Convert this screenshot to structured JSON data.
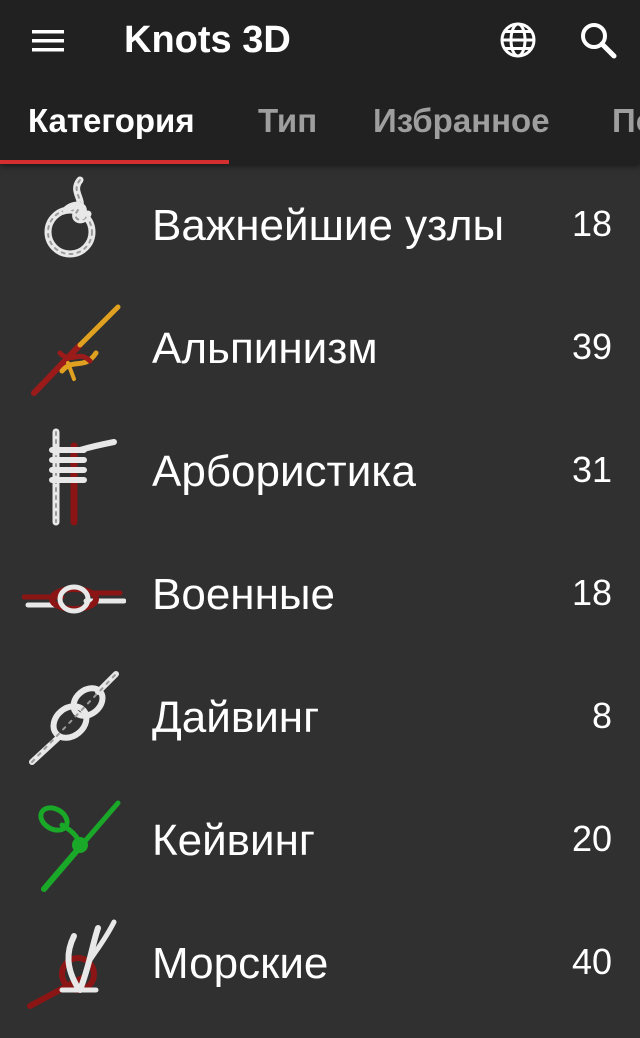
{
  "toolbar": {
    "title": "Knots 3D",
    "menu_icon": "hamburger-menu-icon",
    "language_icon": "globe-icon",
    "search_icon": "search-icon"
  },
  "tabs": [
    {
      "label": "Категория",
      "active": true
    },
    {
      "label": "Тип",
      "active": false
    },
    {
      "label": "Избранное",
      "active": false
    },
    {
      "label": "По",
      "active": false
    }
  ],
  "categories": [
    {
      "label": "Важнейшие узлы",
      "count": "18",
      "icon": "loop-knot-icon"
    },
    {
      "label": "Альпинизм",
      "count": "39",
      "icon": "climbing-knot-icon"
    },
    {
      "label": "Арбористика",
      "count": "31",
      "icon": "arborist-knot-icon"
    },
    {
      "label": "Военные",
      "count": "18",
      "icon": "square-knot-icon"
    },
    {
      "label": "Дайвинг",
      "count": "8",
      "icon": "figure-eight-knot-icon"
    },
    {
      "label": "Кейвинг",
      "count": "20",
      "icon": "caving-knot-icon"
    },
    {
      "label": "Морские",
      "count": "40",
      "icon": "marine-knot-icon"
    }
  ],
  "colors": {
    "appbar": "#212121",
    "background": "#303030",
    "indicator": "#d32f2f",
    "tab_inactive": "#9e9e9e"
  }
}
